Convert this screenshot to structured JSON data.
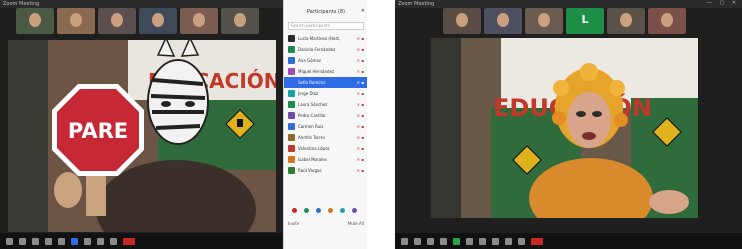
{
  "left_screen": {
    "title_bar": "Zoom Meeting",
    "window_controls": "— ▢ ✕",
    "thumbnails": [
      {
        "type": "video",
        "bg": "#4a5a45"
      },
      {
        "type": "video",
        "bg": "#8a6a50"
      },
      {
        "type": "video",
        "bg": "#5c4f4f"
      },
      {
        "type": "video",
        "bg": "#3e4a5a"
      },
      {
        "type": "video",
        "bg": "#7a5d50"
      },
      {
        "type": "video",
        "bg": "#55524c"
      }
    ],
    "stop_sign_text": "PARE",
    "background_text": "EDUCACIÓN",
    "participants_panel": {
      "title": "Participants (8)",
      "search_placeholder": "Search participants",
      "items": [
        {
          "name": "Lucía Martínez (Host, me)",
          "status": "✕ ▪",
          "color": "#2b2b2b",
          "selected": false
        },
        {
          "name": "Daniela Fernández",
          "status": "✕ ▪",
          "color": "#1f8a4c",
          "selected": false
        },
        {
          "name": "Ana Gómez",
          "status": "✕ ▪",
          "color": "#2f6bd1",
          "selected": false
        },
        {
          "name": "Miguel Hernández",
          "status": "✕ ▪",
          "color": "#a04bb5",
          "selected": false
        },
        {
          "name": "Sofía Ramírez",
          "status": "✕ ▪",
          "color": "#2e6be6",
          "selected": true
        },
        {
          "name": "Jorge Díaz",
          "status": "✕ ▪",
          "color": "#19a3a3",
          "selected": false
        },
        {
          "name": "Laura Sánchez",
          "status": "✕ ▪",
          "color": "#1f8a4c",
          "selected": false
        },
        {
          "name": "Pedro Castillo",
          "status": "✕ ▪",
          "color": "#6b4fa6",
          "selected": false
        },
        {
          "name": "Carmen Ruiz",
          "status": "✕ ▪",
          "color": "#2f6bd1",
          "selected": false
        },
        {
          "name": "Andrés Torres",
          "status": "✕ ▪",
          "color": "#8c6d2a",
          "selected": false
        },
        {
          "name": "Valentina López",
          "status": "✕ ▪",
          "color": "#c23a2e",
          "selected": false
        },
        {
          "name": "Isabel Morales",
          "status": "✕ ▪",
          "color": "#d07a1e",
          "selected": false
        },
        {
          "name": "Raúl Vargas",
          "status": "✕ ▪",
          "color": "#2e7d32",
          "selected": false
        }
      ],
      "color_dots": [
        "#c62828",
        "#1f8a4c",
        "#2f6bd1",
        "#d07a1e",
        "#19a3a3",
        "#6b4fa6"
      ],
      "footer_left": "Invite",
      "footer_right": "Mute All"
    }
  },
  "right_screen": {
    "title_bar": "Zoom Meeting",
    "window_controls": "— ▢ ✕",
    "thumbnails": [
      {
        "type": "video",
        "bg": "#5a4c44"
      },
      {
        "type": "video",
        "bg": "#4e5060"
      },
      {
        "type": "video",
        "bg": "#6a5a52"
      },
      {
        "type": "initial",
        "letter": "L",
        "bg": "#1d8f46"
      },
      {
        "type": "video",
        "bg": "#5a5248"
      },
      {
        "type": "video",
        "bg": "#7a5048"
      }
    ],
    "background_text": "EDUCACIÓN"
  }
}
